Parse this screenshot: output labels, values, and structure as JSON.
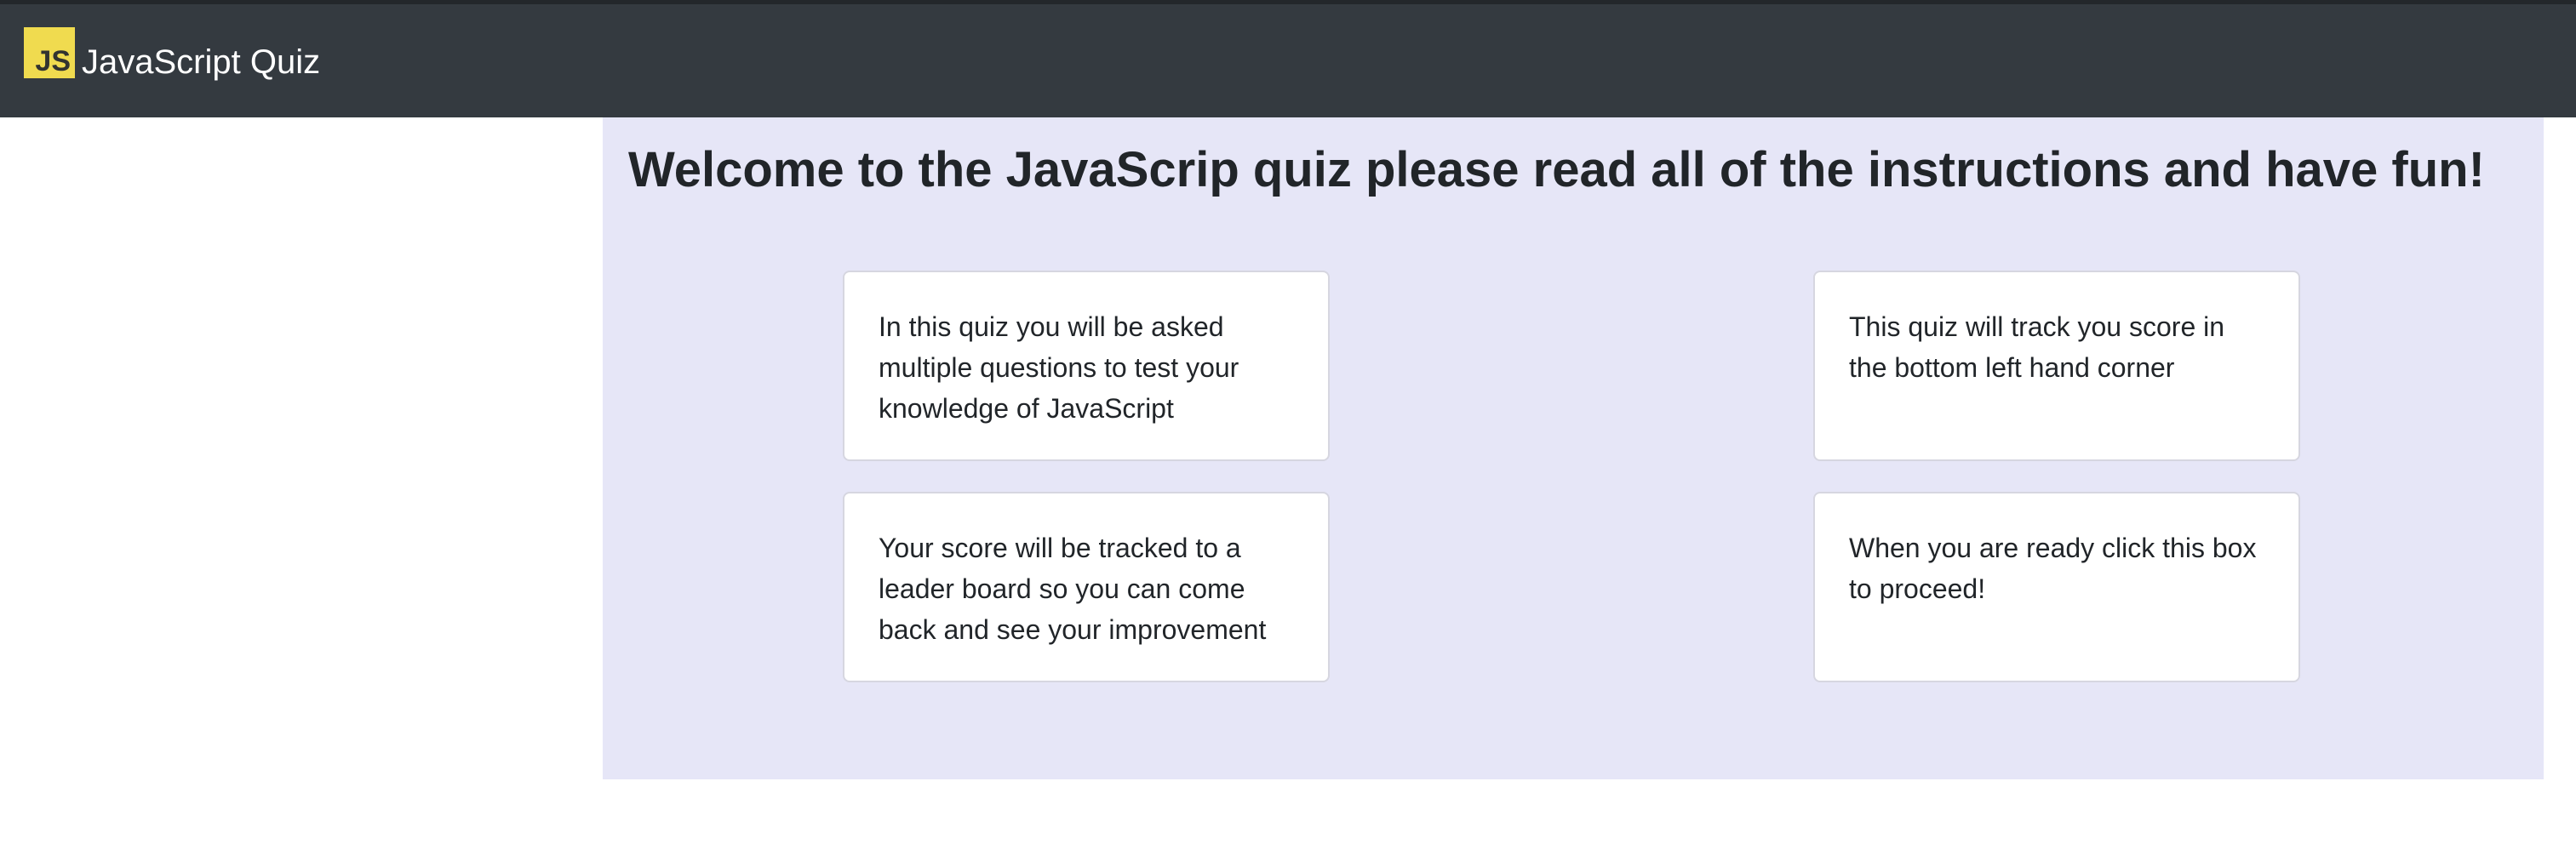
{
  "navbar": {
    "logo_text": "JS",
    "title": "JavaScript Quiz"
  },
  "main": {
    "heading": "Welcome to the JavaScrip quiz please read all of the instructions and have fun!",
    "cards": [
      {
        "text": "In this quiz you will be asked multiple questions to test your knowledge of JavaScript"
      },
      {
        "text": "This quiz will track you score in the bottom left hand corner"
      },
      {
        "text": "Your score will be tracked to a leader board so you can come back and see your improvement"
      },
      {
        "text": "When you are ready click this box to proceed!"
      }
    ]
  },
  "colors": {
    "navbar": "#343a40",
    "panel": "#e6e6f7",
    "logo": "#f0db4f"
  }
}
